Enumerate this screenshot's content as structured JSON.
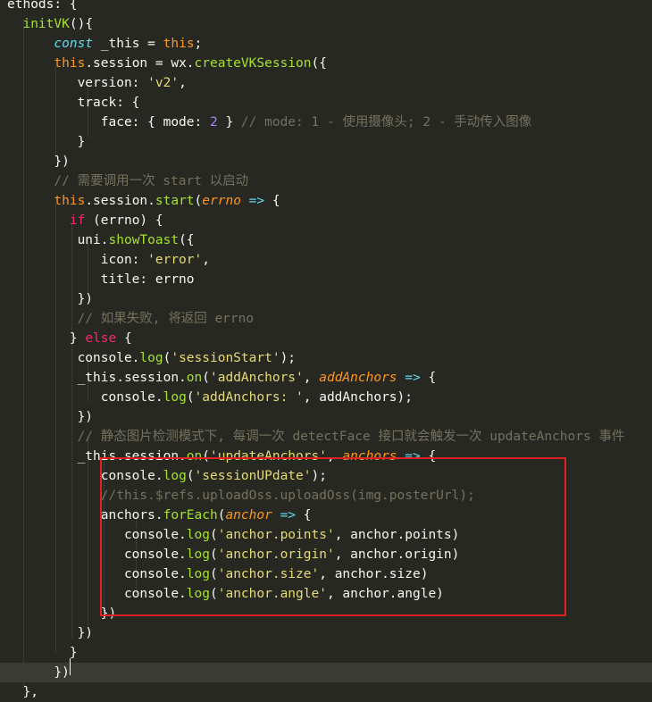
{
  "editor": {
    "theme_colors": {
      "background": "#272822",
      "keyword": "#f92672",
      "function": "#a6e22e",
      "string": "#e6db74",
      "number": "#ae81ff",
      "comment": "#75715e",
      "storage": "#66d9ef",
      "highlight_box": "#e02222"
    },
    "current_line_index": 34,
    "lines": [
      [
        [
          "plain",
          "ethods: {"
        ]
      ],
      [
        [
          "plain",
          "  "
        ],
        [
          "function",
          "initVK"
        ],
        [
          "plain",
          "(){"
        ]
      ],
      [
        [
          "plain",
          "      "
        ],
        [
          "storage",
          "const"
        ],
        [
          "plain",
          " _this = "
        ],
        [
          "this",
          "this"
        ],
        [
          "plain",
          ";"
        ]
      ],
      [
        [
          "plain",
          "      "
        ],
        [
          "this",
          "this"
        ],
        [
          "plain",
          ".session = wx."
        ],
        [
          "function",
          "createVKSession"
        ],
        [
          "plain",
          "({"
        ]
      ],
      [
        [
          "plain",
          "         version: "
        ],
        [
          "string",
          "'v2'"
        ],
        [
          "plain",
          ","
        ]
      ],
      [
        [
          "plain",
          "         track: {"
        ]
      ],
      [
        [
          "plain",
          "            face: { mode: "
        ],
        [
          "number",
          "2"
        ],
        [
          "plain",
          " } "
        ],
        [
          "comment",
          "// mode: 1 - 使用摄像头; 2 - 手动传入图像"
        ]
      ],
      [
        [
          "plain",
          "         }"
        ]
      ],
      [
        [
          "plain",
          "      })"
        ]
      ],
      [
        [
          "plain",
          "      "
        ],
        [
          "comment",
          "// 需要调用一次 start 以启动"
        ]
      ],
      [
        [
          "plain",
          "      "
        ],
        [
          "this",
          "this"
        ],
        [
          "plain",
          ".session."
        ],
        [
          "function",
          "start"
        ],
        [
          "plain",
          "("
        ],
        [
          "param",
          "errno"
        ],
        [
          "plain",
          " "
        ],
        [
          "arrow",
          "=>"
        ],
        [
          "plain",
          " {"
        ]
      ],
      [
        [
          "plain",
          "        "
        ],
        [
          "keyword",
          "if"
        ],
        [
          "plain",
          " (errno) {"
        ]
      ],
      [
        [
          "plain",
          "         uni."
        ],
        [
          "function",
          "showToast"
        ],
        [
          "plain",
          "({"
        ]
      ],
      [
        [
          "plain",
          "            icon: "
        ],
        [
          "string",
          "'error'"
        ],
        [
          "plain",
          ","
        ]
      ],
      [
        [
          "plain",
          "            title: errno"
        ]
      ],
      [
        [
          "plain",
          "         })"
        ]
      ],
      [
        [
          "plain",
          "         "
        ],
        [
          "comment",
          "// 如果失败, 将返回 errno"
        ]
      ],
      [
        [
          "plain",
          "        } "
        ],
        [
          "keyword",
          "else"
        ],
        [
          "plain",
          " {"
        ]
      ],
      [
        [
          "plain",
          "         console."
        ],
        [
          "function",
          "log"
        ],
        [
          "plain",
          "("
        ],
        [
          "string",
          "'sessionStart'"
        ],
        [
          "plain",
          ");"
        ]
      ],
      [
        [
          "plain",
          "         _this.session."
        ],
        [
          "function",
          "on"
        ],
        [
          "plain",
          "("
        ],
        [
          "string",
          "'addAnchors'"
        ],
        [
          "plain",
          ", "
        ],
        [
          "param",
          "addAnchors"
        ],
        [
          "plain",
          " "
        ],
        [
          "arrow",
          "=>"
        ],
        [
          "plain",
          " {"
        ]
      ],
      [
        [
          "plain",
          "            console."
        ],
        [
          "function",
          "log"
        ],
        [
          "plain",
          "("
        ],
        [
          "string",
          "'addAnchors: '"
        ],
        [
          "plain",
          ", addAnchors);"
        ]
      ],
      [
        [
          "plain",
          "         })"
        ]
      ],
      [
        [
          "plain",
          "         "
        ],
        [
          "comment",
          "// 静态图片检测模式下, 每调一次 detectFace 接口就会触发一次 updateAnchors 事件"
        ]
      ],
      [
        [
          "plain",
          "         _this.session."
        ],
        [
          "function",
          "on"
        ],
        [
          "plain",
          "("
        ],
        [
          "string",
          "'updateAnchors'"
        ],
        [
          "plain",
          ", "
        ],
        [
          "param",
          "anchors"
        ],
        [
          "plain",
          " "
        ],
        [
          "arrow",
          "=>"
        ],
        [
          "plain",
          " {"
        ]
      ],
      [
        [
          "plain",
          "            console."
        ],
        [
          "function",
          "log"
        ],
        [
          "plain",
          "("
        ],
        [
          "string",
          "'sessionUPdate'"
        ],
        [
          "plain",
          ");"
        ]
      ],
      [
        [
          "plain",
          "            "
        ],
        [
          "comment",
          "//this.$refs.uploadOss.uploadOss(img.posterUrl);"
        ]
      ],
      [
        [
          "plain",
          "            anchors."
        ],
        [
          "function",
          "forEach"
        ],
        [
          "plain",
          "("
        ],
        [
          "param",
          "anchor"
        ],
        [
          "plain",
          " "
        ],
        [
          "arrow",
          "=>"
        ],
        [
          "plain",
          " {"
        ]
      ],
      [
        [
          "plain",
          "               console."
        ],
        [
          "function",
          "log"
        ],
        [
          "plain",
          "("
        ],
        [
          "string",
          "'anchor.points'"
        ],
        [
          "plain",
          ", anchor.points)"
        ]
      ],
      [
        [
          "plain",
          "               console."
        ],
        [
          "function",
          "log"
        ],
        [
          "plain",
          "("
        ],
        [
          "string",
          "'anchor.origin'"
        ],
        [
          "plain",
          ", anchor.origin)"
        ]
      ],
      [
        [
          "plain",
          "               console."
        ],
        [
          "function",
          "log"
        ],
        [
          "plain",
          "("
        ],
        [
          "string",
          "'anchor.size'"
        ],
        [
          "plain",
          ", anchor.size)"
        ]
      ],
      [
        [
          "plain",
          "               console."
        ],
        [
          "function",
          "log"
        ],
        [
          "plain",
          "("
        ],
        [
          "string",
          "'anchor.angle'"
        ],
        [
          "plain",
          ", anchor.angle)"
        ]
      ],
      [
        [
          "plain",
          "            })"
        ]
      ],
      [
        [
          "plain",
          "         })"
        ]
      ],
      [
        [
          "plain",
          "        }"
        ]
      ],
      [
        [
          "plain",
          "      })"
        ]
      ],
      [
        [
          "plain",
          "  },"
        ]
      ]
    ]
  }
}
